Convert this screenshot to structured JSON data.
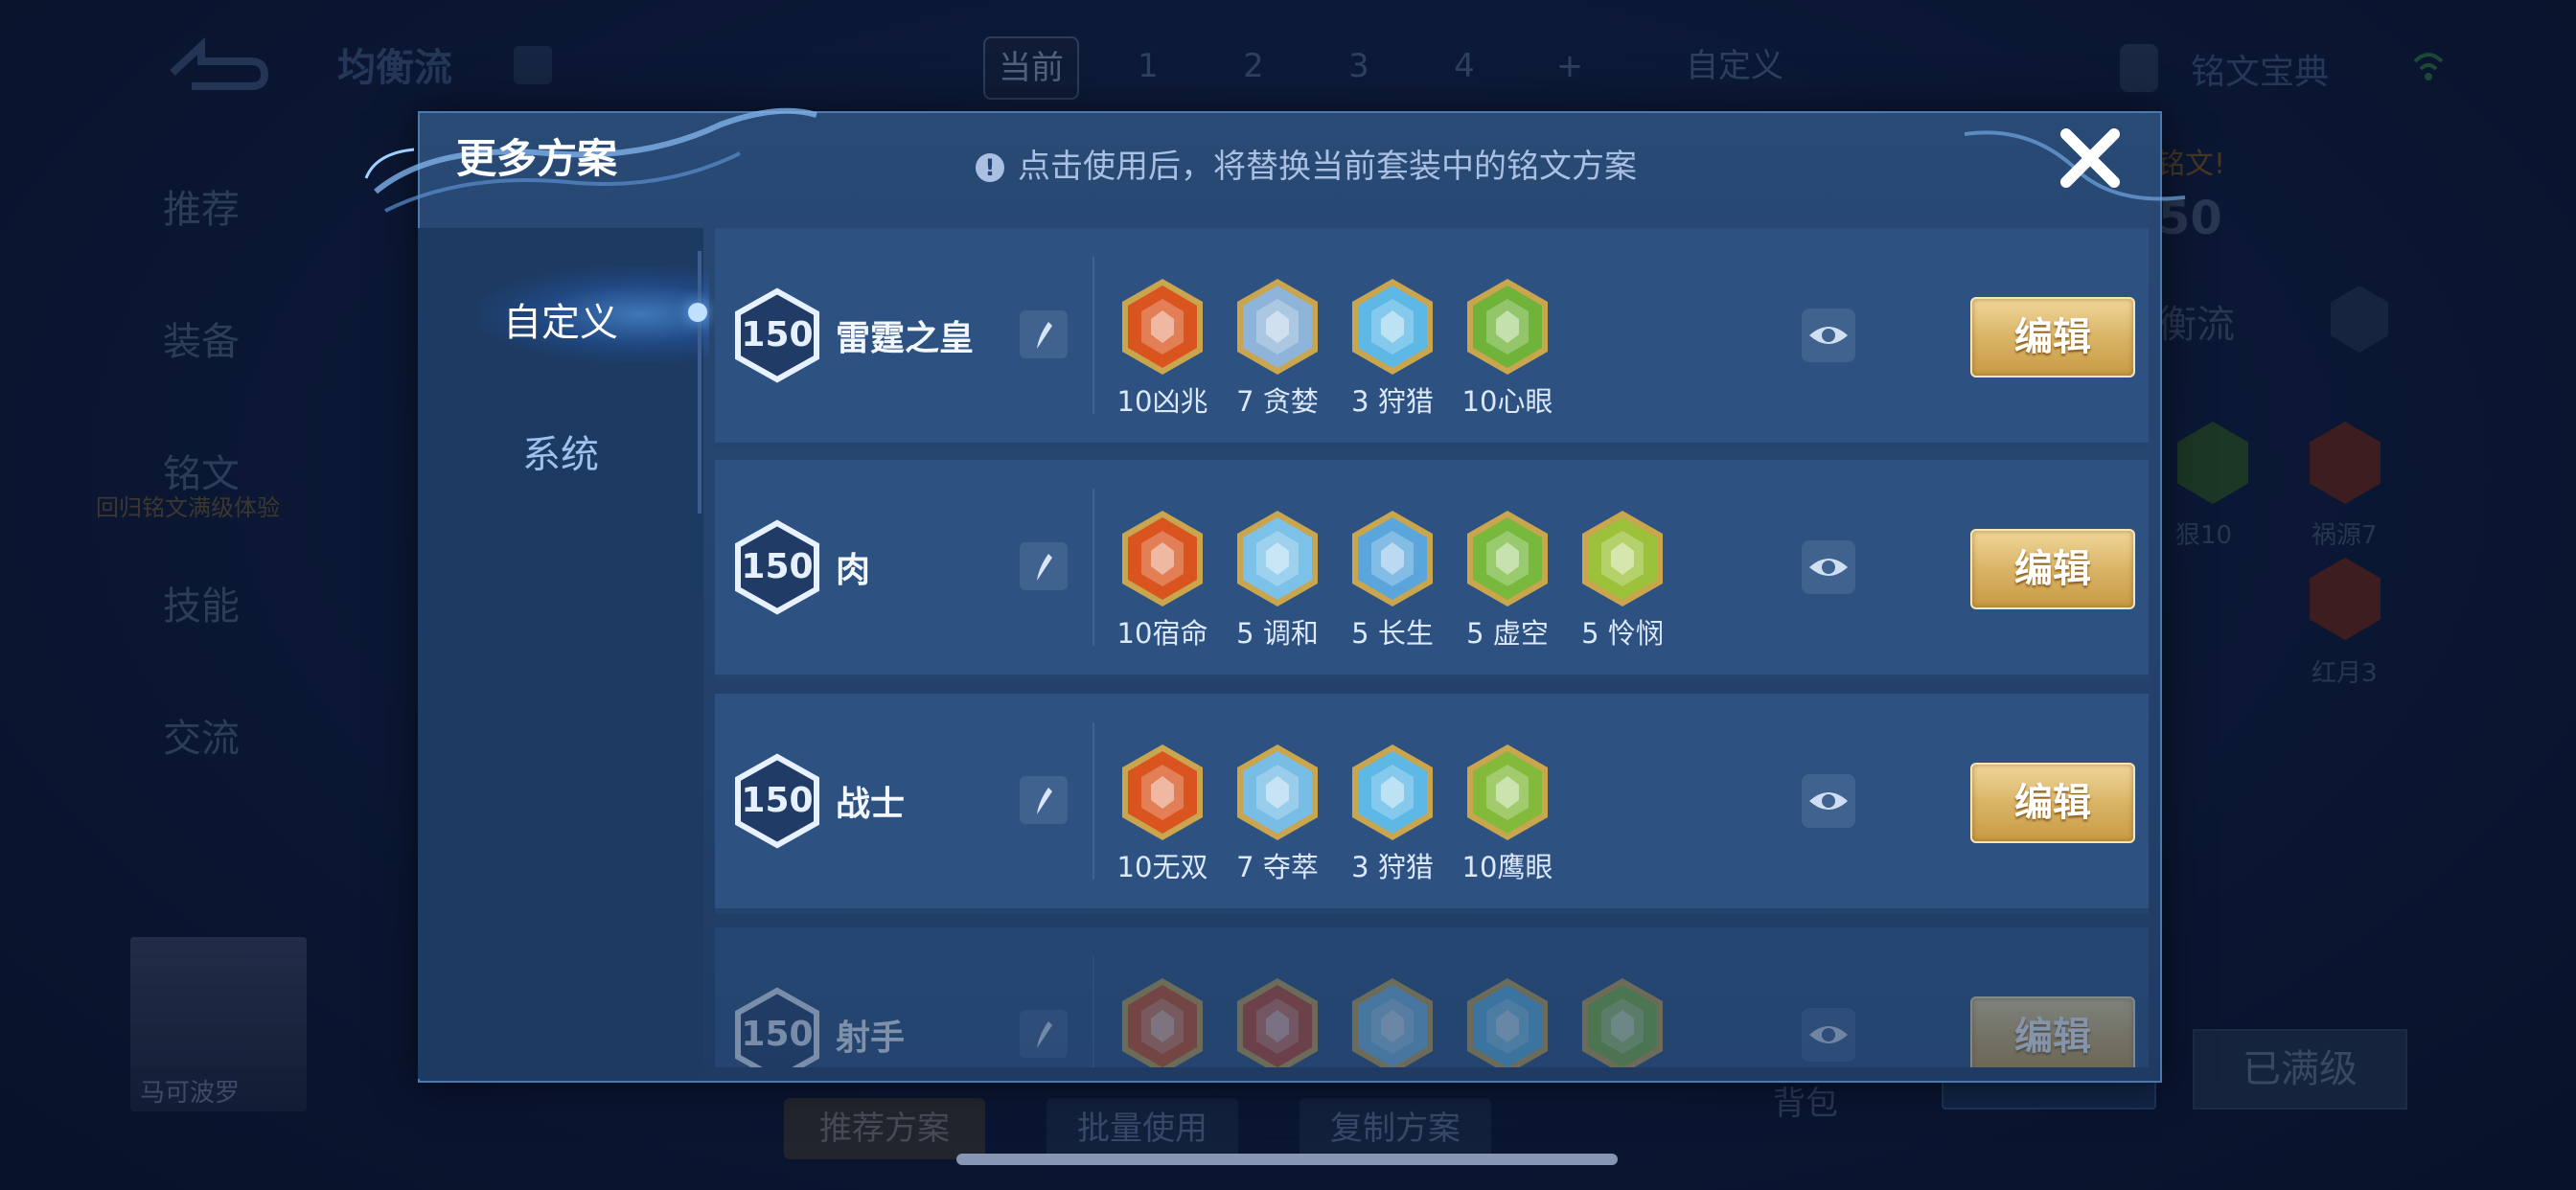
{
  "background": {
    "title": "均衡流",
    "top_tabs": [
      "当前",
      "1",
      "2",
      "3",
      "4",
      "+"
    ],
    "custom_tab": "自定义",
    "codex": "铭文宝典",
    "nav": [
      "推荐",
      "装备",
      "铭文",
      "技能",
      "交流"
    ],
    "nav_sub": "回归铭文满级体验",
    "hero_name": "马可波罗",
    "right_partial": {
      "promo": "铭文!",
      "level": "50",
      "plan_name": "衡流",
      "rune_a": "狠10",
      "rune_b": "祸源7",
      "rune_c": "红月3"
    },
    "bottom_buttons": [
      "推荐方案",
      "批量使用",
      "复制方案"
    ],
    "backpack": "背包",
    "maxed": "已满级"
  },
  "modal": {
    "title": "更多方案",
    "notice_icon": "!",
    "notice": "点击使用后，将替换当前套装中的铭文方案",
    "close_icon": "close-icon",
    "side_tabs": [
      "自定义",
      "系统"
    ],
    "edit_label": "编辑",
    "plans": [
      {
        "level": "150",
        "name": "雷霆之皇",
        "runes": [
          {
            "label": "10凶兆",
            "color": "#d9541f"
          },
          {
            "label": "7 贪婪",
            "color": "#8fb4d9"
          },
          {
            "label": "3 狩猎",
            "color": "#5db8e6"
          },
          {
            "label": "10心眼",
            "color": "#6fb33a"
          }
        ]
      },
      {
        "level": "150",
        "name": "肉",
        "runes": [
          {
            "label": "10宿命",
            "color": "#d9541f"
          },
          {
            "label": "5 调和",
            "color": "#7cc2e8"
          },
          {
            "label": "5 长生",
            "color": "#5aa6dc"
          },
          {
            "label": "5 虚空",
            "color": "#77b83d"
          },
          {
            "label": "5 怜悯",
            "color": "#9bc23a"
          }
        ]
      },
      {
        "level": "150",
        "name": "战士",
        "runes": [
          {
            "label": "10无双",
            "color": "#d9541f"
          },
          {
            "label": "7 夺萃",
            "color": "#78bde6"
          },
          {
            "label": "3 狩猎",
            "color": "#5db8e6"
          },
          {
            "label": "10鹰眼",
            "color": "#83ba3c"
          }
        ]
      },
      {
        "level": "150",
        "name": "射手",
        "runes": [
          {
            "label": "",
            "color": "#d9541f"
          },
          {
            "label": "",
            "color": "#c9482a"
          },
          {
            "label": "",
            "color": "#78bde6"
          },
          {
            "label": "",
            "color": "#5db8e6"
          },
          {
            "label": "",
            "color": "#83ba3c"
          }
        ]
      }
    ]
  }
}
